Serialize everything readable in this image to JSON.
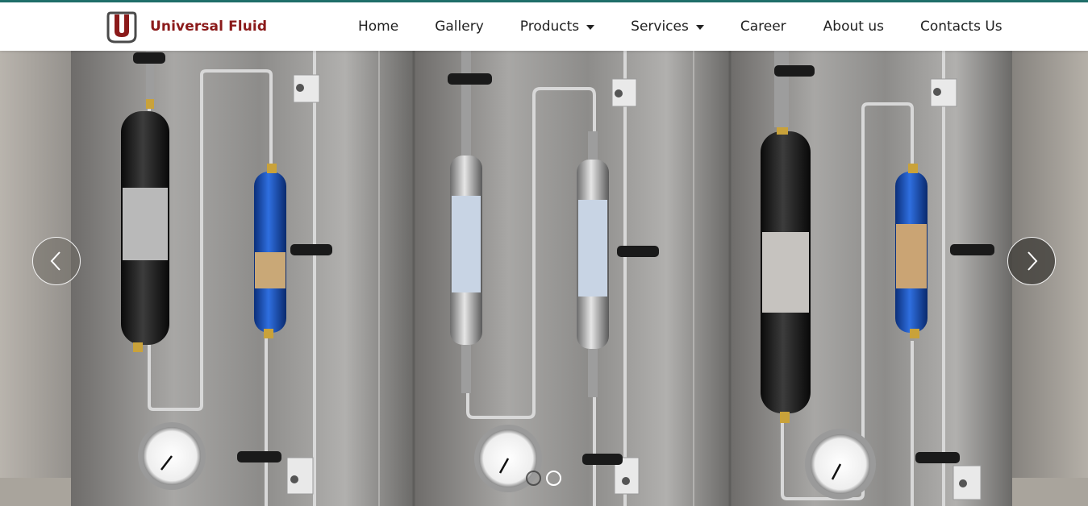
{
  "brand": {
    "name": "Universal Fluid",
    "logo_letter": "U"
  },
  "nav": {
    "items": [
      {
        "label": "Home",
        "has_dropdown": false
      },
      {
        "label": "Gallery",
        "has_dropdown": false
      },
      {
        "label": "Products",
        "has_dropdown": true
      },
      {
        "label": "Services",
        "has_dropdown": true
      },
      {
        "label": "Career",
        "has_dropdown": false
      },
      {
        "label": "About us",
        "has_dropdown": false
      },
      {
        "label": "Contacts Us",
        "has_dropdown": false
      }
    ]
  },
  "carousel": {
    "prev_icon": "chevron-left-icon",
    "next_icon": "chevron-right-icon",
    "slide_count": 2,
    "active_slide": 1
  },
  "colors": {
    "brand": "#8b1a1a",
    "top_accent": "#1f6f6a",
    "nav_text": "#222222"
  }
}
